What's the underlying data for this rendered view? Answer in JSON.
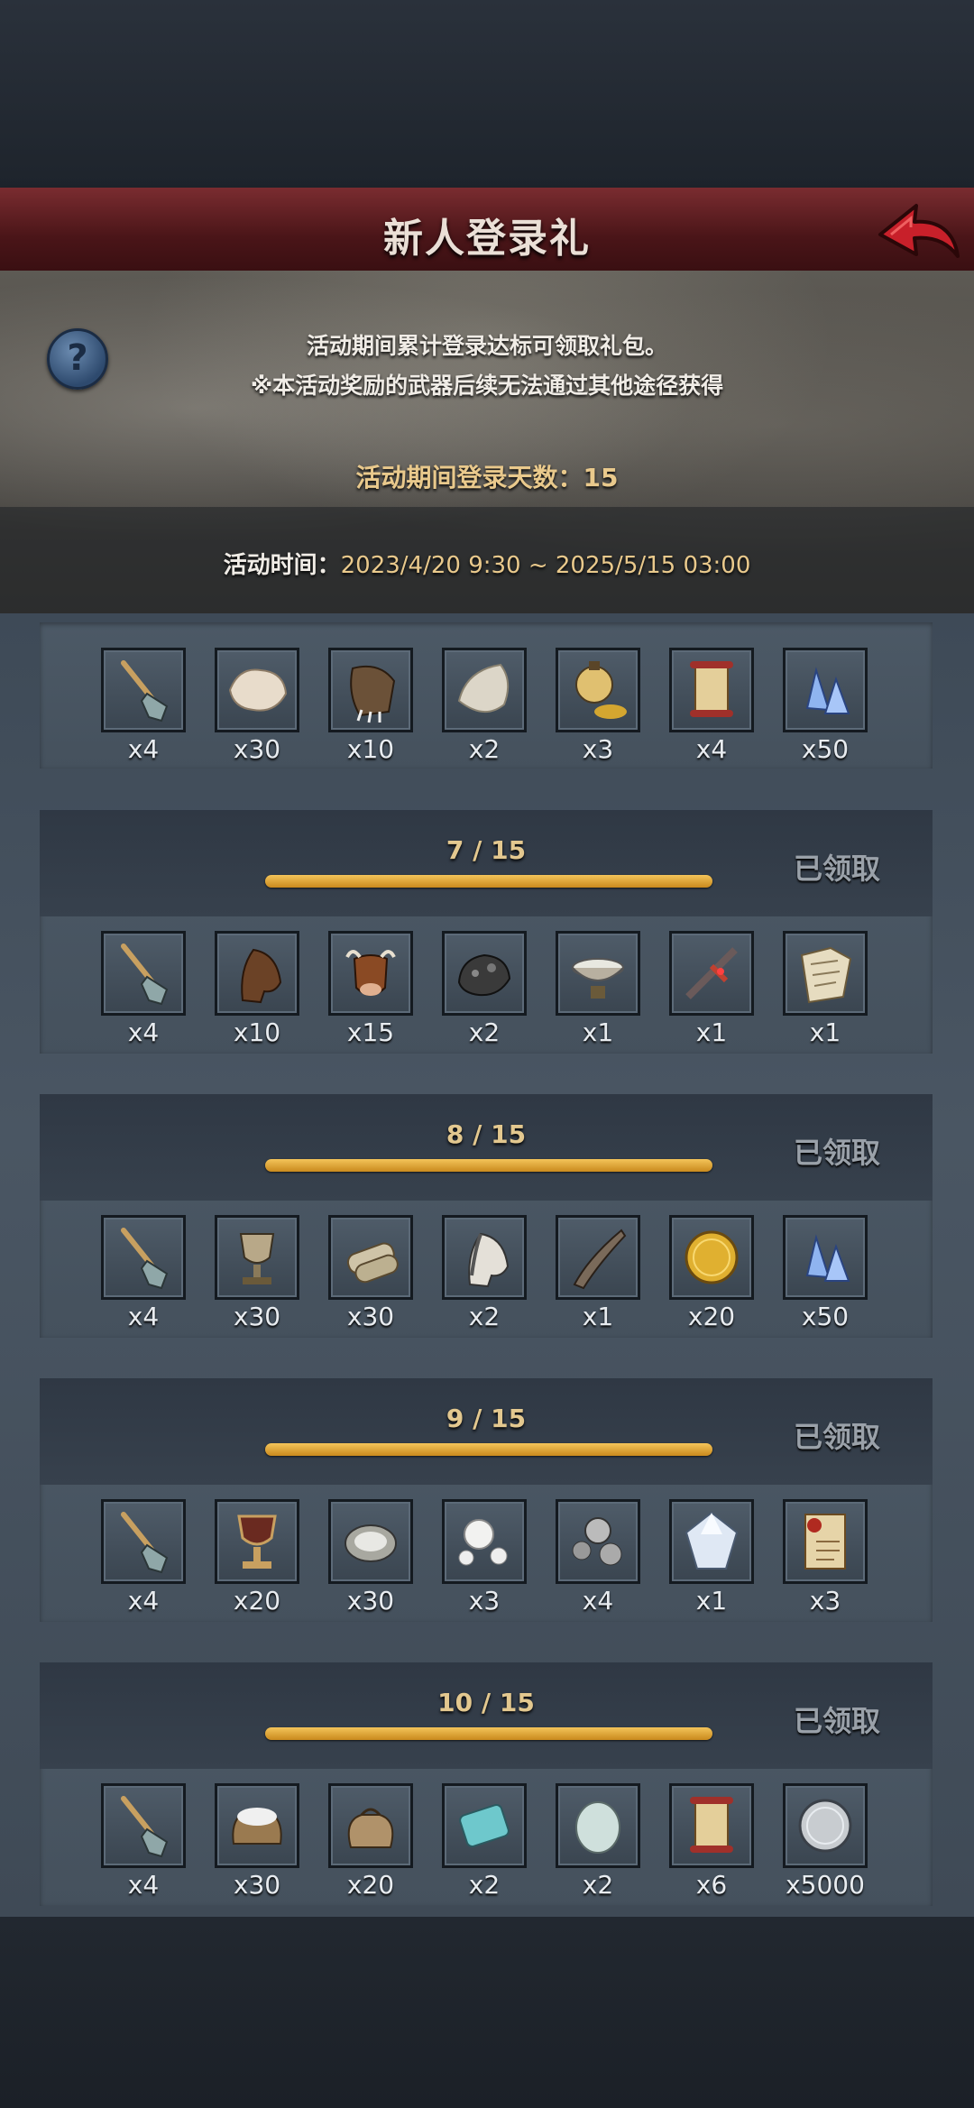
{
  "header": {
    "title": "新人登录礼",
    "back_icon": "back-arrow-icon",
    "accent": "#c8202a"
  },
  "info": {
    "line1": "活动期间累计登录达标可领取礼包。",
    "line2": "※本活动奖励的武器后续无法通过其他途径获得",
    "days_label": "活动期间登录天数：15",
    "time_label": "活动时间：",
    "time_value": "2023/4/20 9:30 ~ 2025/5/15 03:00"
  },
  "rewards": [
    {
      "progress": "",
      "status": "",
      "items": [
        {
          "icon": "shovel-icon",
          "qty": "x4"
        },
        {
          "icon": "wool-pelt-icon",
          "qty": "x30"
        },
        {
          "icon": "bear-claw-icon",
          "qty": "x10"
        },
        {
          "icon": "white-fur-icon",
          "qty": "x2"
        },
        {
          "icon": "potion-coins-icon",
          "qty": "x3"
        },
        {
          "icon": "scroll-icon",
          "qty": "x4"
        },
        {
          "icon": "crystal-icon",
          "qty": "x50"
        }
      ]
    },
    {
      "progress": "7 / 15",
      "status": "已领取",
      "items": [
        {
          "icon": "shovel-icon",
          "qty": "x4"
        },
        {
          "icon": "horse-head-icon",
          "qty": "x10"
        },
        {
          "icon": "cow-head-icon",
          "qty": "x15"
        },
        {
          "icon": "ore-icon",
          "qty": "x2"
        },
        {
          "icon": "bowl-icon",
          "qty": "x1"
        },
        {
          "icon": "sword-icon",
          "qty": "x1"
        },
        {
          "icon": "map-icon",
          "qty": "x1"
        }
      ]
    },
    {
      "progress": "8 / 15",
      "status": "已领取",
      "items": [
        {
          "icon": "shovel-icon",
          "qty": "x4"
        },
        {
          "icon": "goblet-icon",
          "qty": "x30"
        },
        {
          "icon": "cloth-roll-icon",
          "qty": "x30"
        },
        {
          "icon": "white-horse-head-icon",
          "qty": "x2"
        },
        {
          "icon": "horn-icon",
          "qty": "x1"
        },
        {
          "icon": "gold-coin-icon",
          "qty": "x20"
        },
        {
          "icon": "crystal-icon",
          "qty": "x50"
        }
      ]
    },
    {
      "progress": "9 / 15",
      "status": "已领取",
      "items": [
        {
          "icon": "shovel-icon",
          "qty": "x4"
        },
        {
          "icon": "wine-goblet-icon",
          "qty": "x20"
        },
        {
          "icon": "oyster-icon",
          "qty": "x30"
        },
        {
          "icon": "pearls-icon",
          "qty": "x3"
        },
        {
          "icon": "silver-pearls-icon",
          "qty": "x4"
        },
        {
          "icon": "diamond-icon",
          "qty": "x1"
        },
        {
          "icon": "sealed-scroll-icon",
          "qty": "x3"
        }
      ]
    },
    {
      "progress": "10 / 15",
      "status": "已领取",
      "items": [
        {
          "icon": "shovel-icon",
          "qty": "x4"
        },
        {
          "icon": "salt-sack-icon",
          "qty": "x30"
        },
        {
          "icon": "sack-icon",
          "qty": "x20"
        },
        {
          "icon": "teal-cloth-icon",
          "qty": "x2"
        },
        {
          "icon": "egg-stone-icon",
          "qty": "x2"
        },
        {
          "icon": "scroll-icon",
          "qty": "x6"
        },
        {
          "icon": "silver-coin-icon",
          "qty": "x5000"
        }
      ]
    }
  ]
}
